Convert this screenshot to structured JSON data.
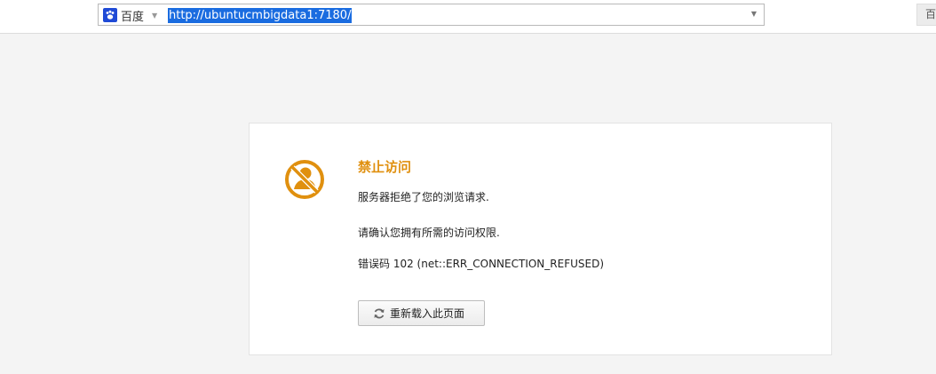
{
  "toolbar": {
    "engine_icon": "baidu-paw-icon",
    "engine_label": "百度",
    "url": "http://ubuntucmbigdata1:7180/",
    "side_button_label": "百"
  },
  "error": {
    "icon": "blocked-user-icon",
    "title": "禁止访问",
    "message": "服务器拒绝了您的浏览请求.",
    "hint": "请确认您拥有所需的访问权限.",
    "code": "错误码 102 (net::ERR_CONNECTION_REFUSED)",
    "reload_icon": "refresh-icon",
    "reload_label": "重新载入此页面"
  },
  "colors": {
    "accent": "#e0900f",
    "url_selection": "#1a6ce0",
    "engine_brand": "#1f4ad6"
  }
}
